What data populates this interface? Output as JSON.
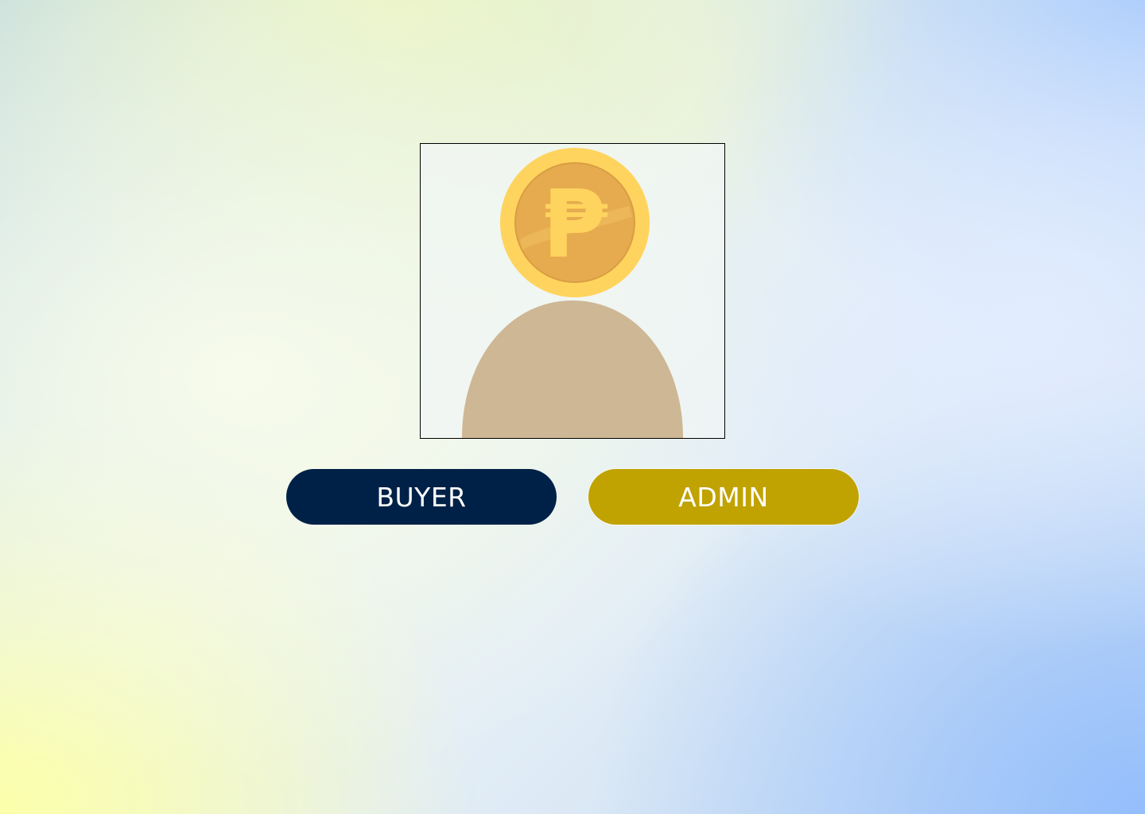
{
  "avatar": {
    "icon": "peso-coin-user-icon",
    "coin_symbol": "₱",
    "colors": {
      "coin_outer": "#ffd45e",
      "coin_inner": "#e6ab4e",
      "coin_symbol": "#ffd45e",
      "body": "#ceb795"
    }
  },
  "buttons": {
    "buyer": {
      "label": "BUYER",
      "color": "#002147"
    },
    "admin": {
      "label": "ADMIN",
      "color": "#c0a200"
    }
  }
}
